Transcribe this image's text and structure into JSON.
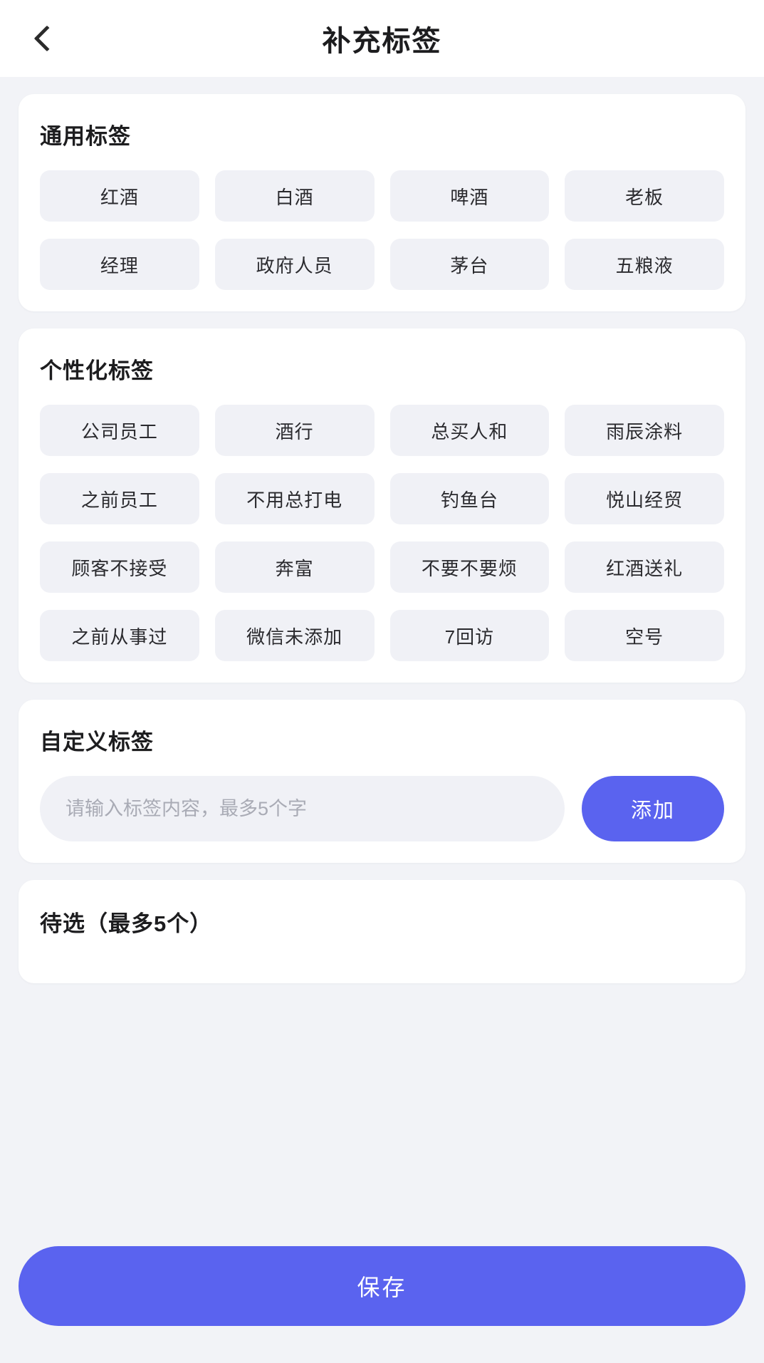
{
  "header": {
    "title": "补充标签",
    "back_icon": "chevron-left-icon"
  },
  "general_tags": {
    "title": "通用标签",
    "tags": [
      "红酒",
      "白酒",
      "啤酒",
      "老板",
      "经理",
      "政府人员",
      "茅台",
      "五粮液"
    ]
  },
  "personalized_tags": {
    "title": "个性化标签",
    "tags": [
      "公司员工",
      "酒行",
      "总买人和",
      "雨辰涂料",
      "之前员工",
      "不用总打电",
      "钓鱼台",
      "悦山经贸",
      "顾客不接受",
      "奔富",
      "不要不要烦",
      "红酒送礼",
      "之前从事过",
      "微信未添加",
      "7回访",
      "空号"
    ]
  },
  "custom_tag": {
    "title": "自定义标签",
    "input_value": "",
    "input_placeholder": "请输入标签内容，最多5个字",
    "add_label": "添加"
  },
  "pending": {
    "title": "待选（最多5个）",
    "items": []
  },
  "footer": {
    "save_label": "保存"
  },
  "colors": {
    "accent": "#5a63ef",
    "page_bg": "#f2f3f7",
    "card_bg": "#ffffff",
    "tag_bg": "#f0f1f6",
    "text_primary": "#1d1d1f",
    "text_placeholder": "#a9abb5"
  }
}
